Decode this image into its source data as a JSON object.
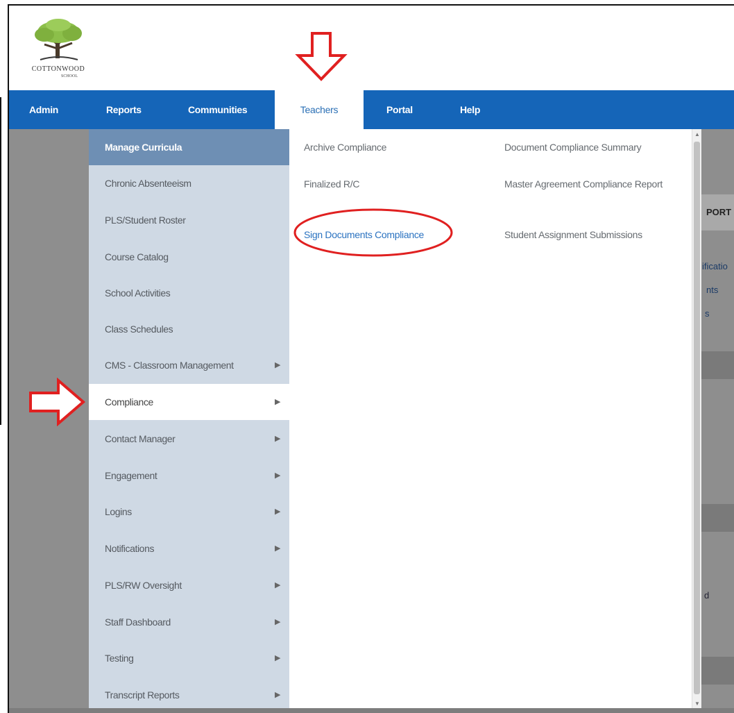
{
  "logo": {
    "name": "COTTONWOOD",
    "sub": "SCHOOL"
  },
  "nav": {
    "items": [
      {
        "label": "Admin"
      },
      {
        "label": "Reports"
      },
      {
        "label": "Communities"
      },
      {
        "label": "Teachers"
      },
      {
        "label": "Portal"
      },
      {
        "label": "Help"
      }
    ],
    "active": "Teachers"
  },
  "submenu": {
    "header": "Manage Curricula",
    "items": [
      {
        "label": "Chronic Absenteeism",
        "has_children": false
      },
      {
        "label": "PLS/Student Roster",
        "has_children": false
      },
      {
        "label": "Course Catalog",
        "has_children": false
      },
      {
        "label": "School Activities",
        "has_children": false
      },
      {
        "label": "Class Schedules",
        "has_children": false
      },
      {
        "label": "CMS - Classroom Management",
        "has_children": true
      },
      {
        "label": "Compliance",
        "has_children": true,
        "selected": true
      },
      {
        "label": "Contact Manager",
        "has_children": true
      },
      {
        "label": "Engagement",
        "has_children": true
      },
      {
        "label": "Logins",
        "has_children": true
      },
      {
        "label": "Notifications",
        "has_children": true
      },
      {
        "label": "PLS/RW Oversight",
        "has_children": true
      },
      {
        "label": "Staff Dashboard",
        "has_children": true
      },
      {
        "label": "Testing",
        "has_children": true
      },
      {
        "label": "Transcript Reports",
        "has_children": true
      }
    ]
  },
  "panel": {
    "col1": [
      {
        "label": "Archive Compliance"
      },
      {
        "label": "Finalized R/C"
      },
      {
        "label": "Sign Documents Compliance",
        "highlighted": true
      }
    ],
    "col2": [
      {
        "label": "Document Compliance Summary"
      },
      {
        "label": "Master Agreement Compliance Report"
      },
      {
        "label": "Student Assignment Submissions"
      }
    ]
  },
  "background_peek": {
    "t1": "PORT",
    "t2": "ificatio",
    "t3": "nts",
    "t4": "s",
    "t5": "d"
  },
  "colors": {
    "nav_bg": "#1565b8",
    "submenu_bg": "#cfd9e4",
    "submenu_header": "#6e8fb4",
    "link_blue": "#2a72c0",
    "annotation_red": "#e02020"
  },
  "icons": {
    "chevron": "chevron-right-icon",
    "arrow_down": "red-arrow-down-annotation",
    "arrow_right": "red-arrow-right-annotation"
  }
}
